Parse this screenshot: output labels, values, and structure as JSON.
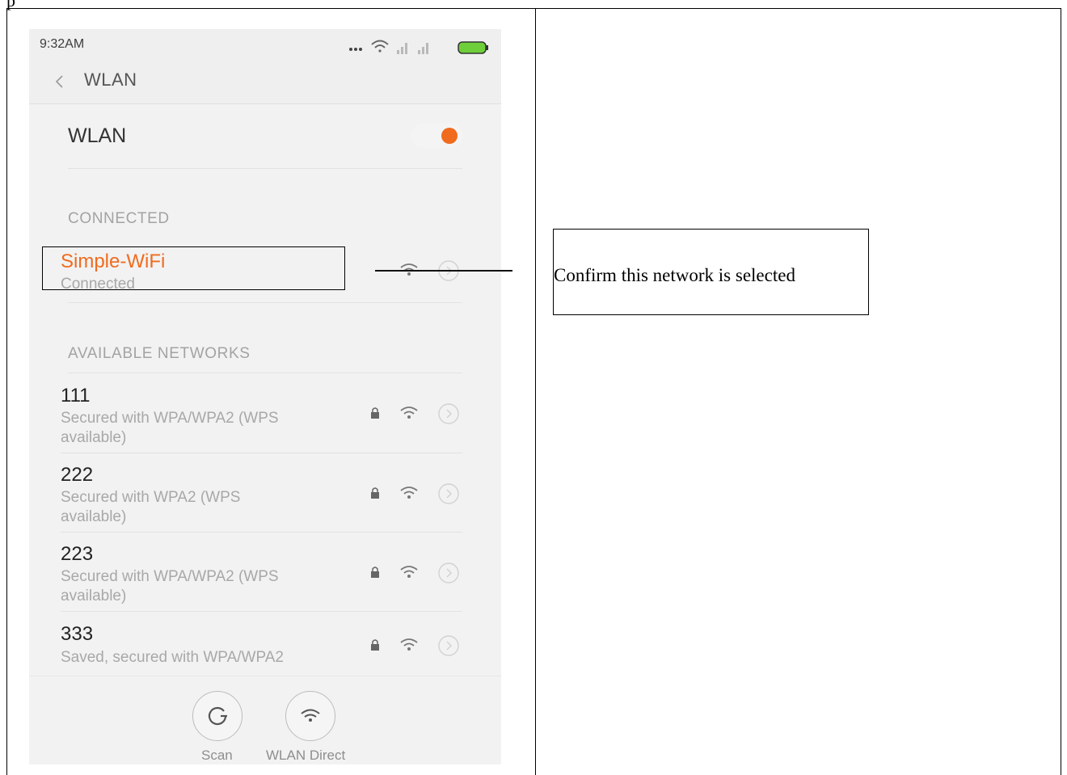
{
  "top_cut_text": "p",
  "phone": {
    "status_bar": {
      "time": "9:32AM",
      "icons": [
        "more-icon",
        "wifi-signal-icon",
        "cell-signal-icon",
        "cell-signal-icon",
        "battery-icon"
      ]
    },
    "title_bar": {
      "back_icon": "chevron-left-icon",
      "title": "WLAN"
    },
    "wlan_toggle": {
      "label": "WLAN",
      "state": "on",
      "accent_color": "#f06b1e"
    },
    "connected_section": {
      "header": "CONNECTED",
      "network": {
        "name": "Simple-WiFi",
        "status": "Connected"
      }
    },
    "available_section": {
      "header": "AVAILABLE NETWORKS",
      "networks": [
        {
          "name": "111",
          "security_line1": "Secured with WPA/WPA2 (WPS",
          "security_line2": "available)"
        },
        {
          "name": "222",
          "security_line1": "Secured with WPA2 (WPS",
          "security_line2": "available)"
        },
        {
          "name": "223",
          "security_line1": "Secured with WPA/WPA2 (WPS",
          "security_line2": "available)"
        },
        {
          "name": "333",
          "security_line1": "Saved, secured with WPA/WPA2",
          "security_line2": ""
        }
      ]
    },
    "bottom_actions": {
      "scan_label": "Scan",
      "scan_icon": "refresh-icon",
      "direct_label": "WLAN Direct",
      "direct_icon": "wifi-icon"
    }
  },
  "callout": {
    "text": "Confirm this network is selected"
  }
}
